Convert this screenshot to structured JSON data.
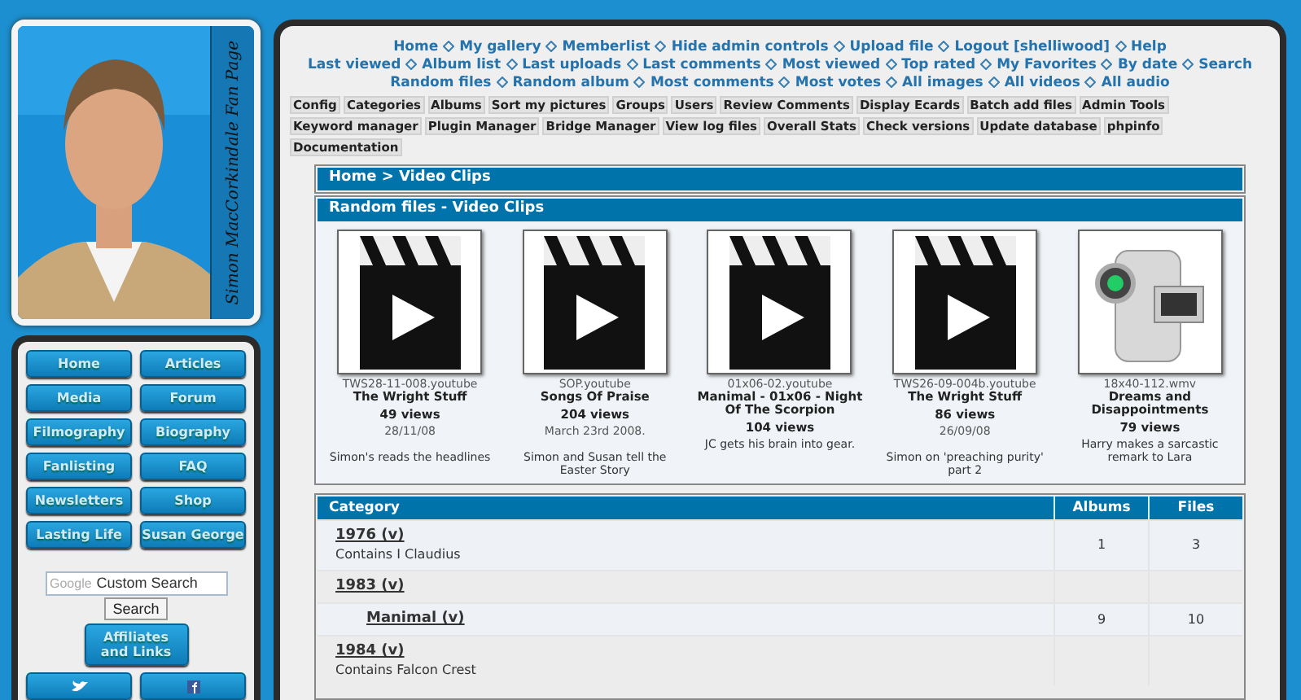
{
  "sidebar": {
    "banner_title": "Simon MacCorkindale Fan Page",
    "nav": [
      "Home",
      "Articles",
      "Media",
      "Forum",
      "Filmography",
      "Biography",
      "Fanlisting",
      "FAQ",
      "Newsletters",
      "Shop",
      "Lasting Life",
      "Susan George"
    ],
    "search": {
      "brand": "Google",
      "placeholder": "Custom Search",
      "button": "Search"
    },
    "affiliates": "Affiliates and Links",
    "social": [
      {
        "kind": "bird"
      },
      {
        "kind": "facebook"
      }
    ]
  },
  "main": {
    "nav_lines": [
      [
        "Home",
        "My gallery",
        "Memberlist",
        "Hide admin controls",
        "Upload file",
        "Logout [shelliwood]",
        "Help"
      ],
      [
        "Last viewed",
        "Album list",
        "Last uploads",
        "Last comments",
        "Most viewed",
        "Top rated",
        "My Favorites",
        "By date",
        "Search"
      ],
      [
        "Random files",
        "Random album",
        "Most comments",
        "Most votes",
        "All images",
        "All videos",
        "All audio"
      ]
    ],
    "admin_buttons": [
      "Config",
      "Categories",
      "Albums",
      "Sort my pictures",
      "Groups",
      "Users",
      "Review Comments",
      "Display Ecards",
      "Batch add files",
      "Admin Tools",
      "Keyword manager",
      "Plugin Manager",
      "Bridge Manager",
      "View log files",
      "Overall Stats",
      "Check versions",
      "Update database",
      "phpinfo",
      "Documentation"
    ],
    "breadcrumb": "Home > Video Clips",
    "random": {
      "title": "Random files - Video Clips",
      "items": [
        {
          "kind": "clip",
          "filename": "TWS28-11-008.youtube",
          "title": "The Wright Stuff",
          "views": "49 views",
          "date": "28/11/08",
          "caption": "Simon's reads the headlines"
        },
        {
          "kind": "clip",
          "filename": "SOP.youtube",
          "title": "Songs Of Praise",
          "views": "204 views",
          "date": "March 23rd 2008.",
          "caption": "Simon and Susan tell the Easter Story"
        },
        {
          "kind": "clip",
          "filename": "01x06-02.youtube",
          "title": "Manimal - 01x06 - Night Of The Scorpion",
          "views": "104 views",
          "caption": "JC gets his brain into gear."
        },
        {
          "kind": "clip",
          "filename": "TWS26-09-004b.youtube",
          "title": "The Wright Stuff",
          "views": "86 views",
          "date": "26/09/08",
          "caption": "Simon on 'preaching purity' part 2"
        },
        {
          "kind": "camcorder",
          "filename": "18x40-112.wmv",
          "title": "Dreams and Disappointments",
          "views": "79 views",
          "caption": "Harry makes a sarcastic remark to Lara"
        }
      ]
    },
    "table": {
      "columns": [
        "Category",
        "Albums",
        "Files"
      ],
      "rows": [
        {
          "name": "1976 (v)",
          "description": "Contains I Claudius",
          "albums": "1",
          "files": "3"
        },
        {
          "name": "1983 (v)",
          "children": [
            {
              "name": "Manimal (v)",
              "albums": "9",
              "files": "10"
            }
          ]
        },
        {
          "name": "1984 (v)",
          "description": "Contains Falcon Crest"
        }
      ]
    }
  }
}
